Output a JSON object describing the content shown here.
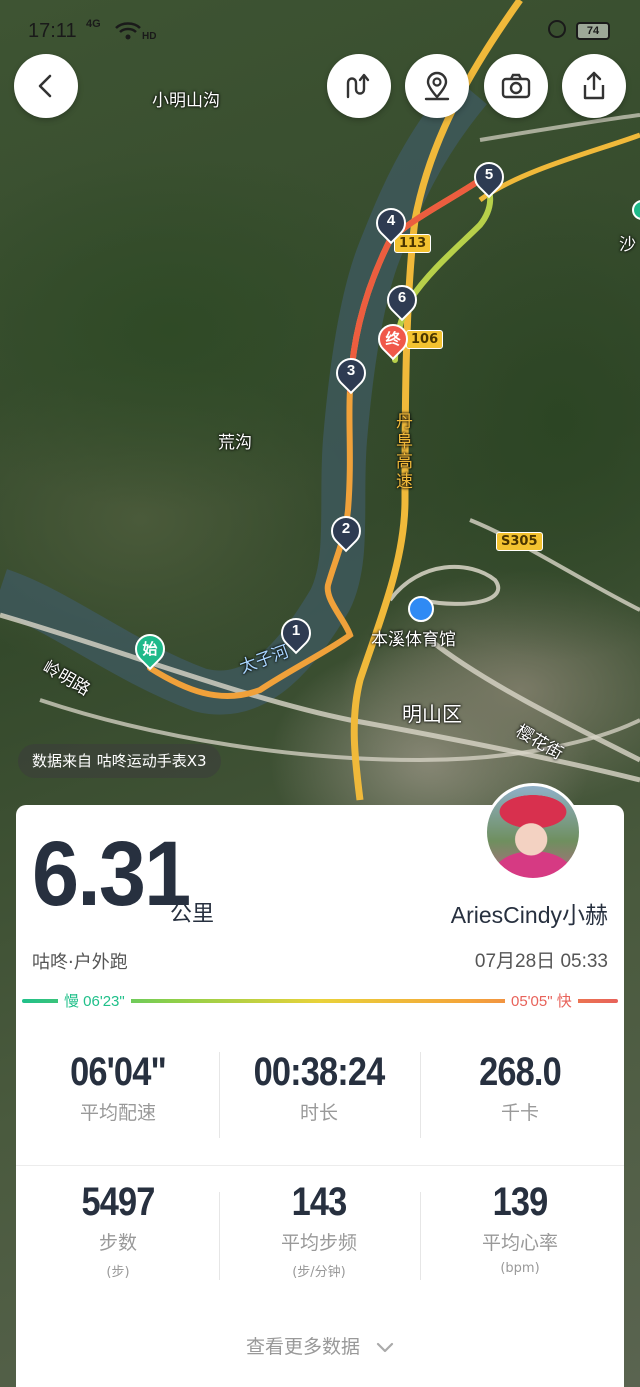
{
  "status_bar": {
    "time": "17:11",
    "network": "4G",
    "wifi": "HD",
    "battery": "74"
  },
  "map": {
    "labels": {
      "xiaoming": "小明山沟",
      "huanggou": "荒沟",
      "sha": "沙",
      "taizi": "太子河",
      "lingming": "岭明路",
      "benxi": "本溪体育馆",
      "mingshan": "明山区",
      "yinghua": "樱花街",
      "danfu": "丹阜高速"
    },
    "shields": {
      "g113": "113",
      "g106": "106",
      "s305": "S305"
    },
    "markers": {
      "start": "始",
      "end": "终",
      "km1": "1",
      "km2": "2",
      "km3": "3",
      "km4": "4",
      "km5": "5",
      "km6": "6"
    },
    "source": "数据来自 咕咚运动手表X3"
  },
  "summary": {
    "distance": "6.31",
    "distance_unit": "公里",
    "username": "AriesCindy小赫",
    "activity_type": "咕咚·户外跑",
    "date": "07月28日 05:33",
    "pace_slow": "慢 06'23\"",
    "pace_fast": "05'05\" 快"
  },
  "stats": {
    "pace": {
      "value": "06'04\"",
      "label": "平均配速"
    },
    "duration": {
      "value": "00:38:24",
      "label": "时长"
    },
    "calories": {
      "value": "268.0",
      "label": "千卡"
    },
    "steps": {
      "value": "5497",
      "label": "步数",
      "unit": "(步)"
    },
    "cadence": {
      "value": "143",
      "label": "平均步频",
      "unit": "(步/分钟)"
    },
    "heart_rate": {
      "value": "139",
      "label": "平均心率",
      "unit": "(bpm)"
    }
  },
  "more_data": "查看更多数据",
  "colors": {
    "slow": "#20c08a",
    "fast": "#e8625a",
    "marker": "#2e3b52"
  }
}
